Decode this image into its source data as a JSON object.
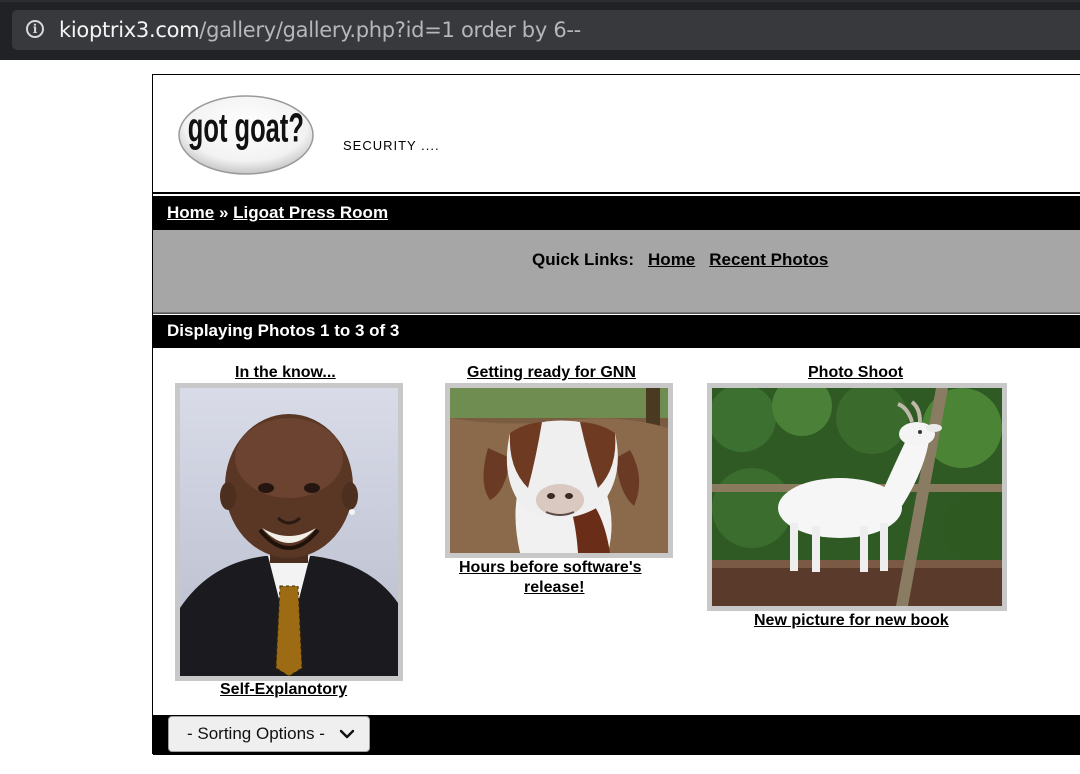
{
  "browser": {
    "url_host": "kioptrix3.com",
    "url_path": "/gallery/gallery.php?id=1 order by 6--"
  },
  "header": {
    "logo_text": "got goat?",
    "tagline": "SECURITY ...."
  },
  "breadcrumb": {
    "home": "Home",
    "separator": " » ",
    "current": "Ligoat Press Room"
  },
  "quick_links": {
    "label": "Quick Links:",
    "home": "Home",
    "recent": "Recent Photos"
  },
  "display": {
    "text": "Displaying Photos 1 to 3 of 3"
  },
  "photos": [
    {
      "title": "In the know...",
      "caption": "Self-Explanotory"
    },
    {
      "title": "Getting ready for GNN",
      "caption_line1": "Hours before software's",
      "caption_line2": "release!"
    },
    {
      "title": "Photo Shoot",
      "caption": "New picture for new book"
    }
  ],
  "sorting": {
    "label": "- Sorting Options -"
  }
}
